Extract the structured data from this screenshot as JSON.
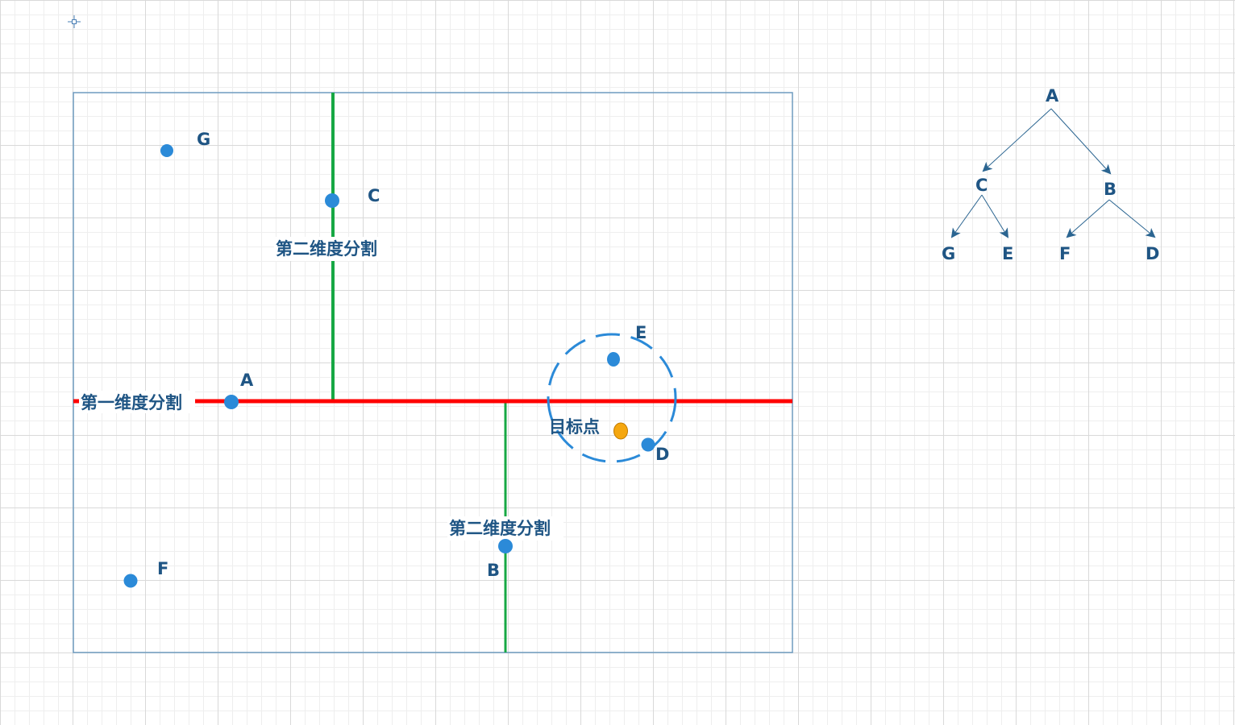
{
  "colors": {
    "point": "#2b8ad8",
    "target_point": "#f5a70f",
    "first_split": "#ff0000",
    "second_split": "#17a844",
    "frame": "#6f9cbf",
    "label": "#1f5584",
    "circle": "#2b8ad8",
    "tree_edge": "#2b6591"
  },
  "points": [
    {
      "id": "A",
      "label": "A"
    },
    {
      "id": "B",
      "label": "B"
    },
    {
      "id": "C",
      "label": "C"
    },
    {
      "id": "D",
      "label": "D"
    },
    {
      "id": "E",
      "label": "E"
    },
    {
      "id": "F",
      "label": "F"
    },
    {
      "id": "G",
      "label": "G"
    }
  ],
  "target": {
    "label": "目标点"
  },
  "splits": {
    "first": {
      "label": "第一维度分割"
    },
    "second_top": {
      "label": "第二维度分割"
    },
    "second_bottom": {
      "label": "第二维度分割"
    }
  },
  "tree": {
    "root": "A",
    "nodes": [
      {
        "label": "A"
      },
      {
        "label": "C"
      },
      {
        "label": "B"
      },
      {
        "label": "G"
      },
      {
        "label": "E"
      },
      {
        "label": "F"
      },
      {
        "label": "D"
      }
    ]
  }
}
